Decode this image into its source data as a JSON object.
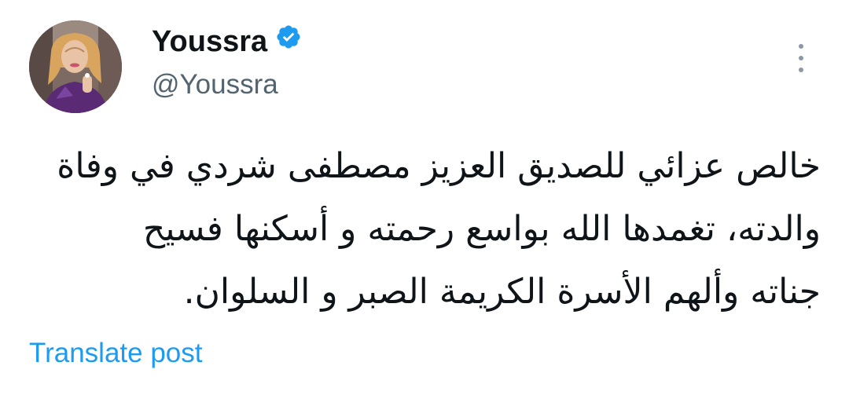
{
  "author": {
    "display_name": "Youssra",
    "handle": "@Youssra",
    "verified": true,
    "verified_color": "#1d9bf0"
  },
  "tweet": {
    "lines": [
      "خالص عزائي للصديق العزيز مصطفى شردي في وفاة",
      "والدته، تغمدها الله بواسع رحمته و أسكنها فسيح",
      "جناته وألهم الأسرة الكريمة الصبر و السلوان."
    ]
  },
  "actions": {
    "translate_label": "Translate post",
    "more_icon": "more-vertical-icon"
  },
  "colors": {
    "text": "#0f1419",
    "secondary": "#536471",
    "link": "#1d9bf0"
  }
}
